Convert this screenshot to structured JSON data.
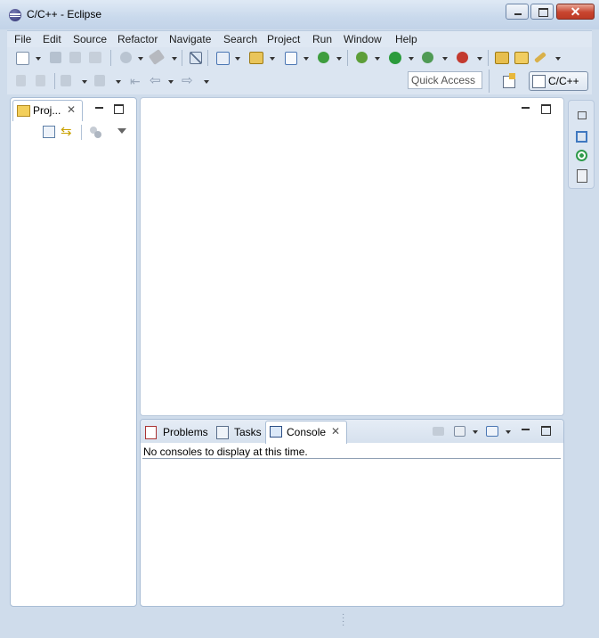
{
  "window": {
    "title": "C/C++ - Eclipse",
    "close_glyph": "✕"
  },
  "menu": [
    "File",
    "Edit",
    "Source",
    "Refactor",
    "Navigate",
    "Search",
    "Project",
    "Run",
    "Window",
    "Help"
  ],
  "toolbar": {
    "quick_access_placeholder": "Quick Access",
    "perspective_label": "C/C++"
  },
  "project_view": {
    "tab_label": "Proj...",
    "close_glyph": "✕"
  },
  "console_view": {
    "tabs": [
      {
        "label": "Problems",
        "icon": "problems-icon"
      },
      {
        "label": "Tasks",
        "icon": "tasks-icon"
      },
      {
        "label": "Console",
        "icon": "console-icon",
        "active": true
      }
    ],
    "close_glyph": "✕",
    "message": "No consoles to display at this time."
  },
  "colors": {
    "accent": "#c2d3e8",
    "close_button": "#c8452f",
    "panel_border": "#a9bdd5"
  }
}
